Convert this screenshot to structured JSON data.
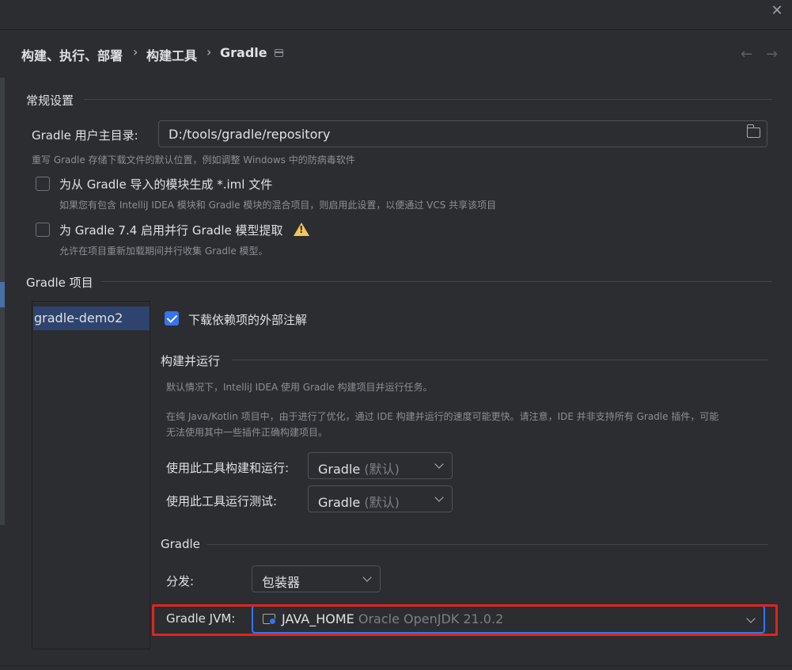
{
  "window": {
    "close_glyph": "✕"
  },
  "breadcrumb": {
    "items": [
      "构建、执行、部署",
      "构建工具",
      "Gradle"
    ],
    "separator": "›",
    "back_glyph": "←",
    "forward_glyph": "→"
  },
  "general": {
    "title": "常规设置",
    "user_home_label": "Gradle 用户主目录:",
    "user_home_value": "D:/tools/gradle/repository",
    "user_home_hint": "重写 Gradle 存储下载文件的默认位置，例如调整 Windows 中的防病毒软件",
    "iml_label": "为从 Gradle 导入的模块生成 *.iml 文件",
    "iml_hint": "如果您有包含 IntelliJ IDEA 模块和 Gradle 模块的混合项目，则启用此设置，以便通过 VCS 共享该项目",
    "iml_checked": false,
    "parallel_label": "为 Gradle 7.4 启用并行 Gradle 模型提取",
    "parallel_hint": "允许在项目重新加载期间并行收集 Gradle 模型。",
    "parallel_checked": false
  },
  "projects": {
    "title": "Gradle 项目",
    "items": [
      "gradle-demo2"
    ],
    "download_annotations_label": "下载依赖项的外部注解",
    "download_annotations_checked": true
  },
  "build_run": {
    "title": "构建并运行",
    "desc1": "默认情况下，IntelliJ IDEA 使用 Gradle 构建项目并运行任务。",
    "desc2_line1": "在纯 Java/Kotlin 项目中，由于进行了优化，通过 IDE 构建并运行的速度可能更快。请注意，IDE 并非支持所有 Gradle 插件，可能",
    "desc2_line2": "无法使用其中一些插件正确构建项目。",
    "build_with_label": "使用此工具构建和运行:",
    "build_with_value": "Gradle",
    "build_with_suffix": "(默认)",
    "test_with_label": "使用此工具运行测试:",
    "test_with_value": "Gradle",
    "test_with_suffix": "(默认)"
  },
  "gradle": {
    "title": "Gradle",
    "distribution_label": "分发:",
    "distribution_value": "包装器",
    "jvm_label": "Gradle JVM:",
    "jvm_value": "JAVA_HOME",
    "jvm_detail": "Oracle OpenJDK 21.0.2"
  },
  "colors": {
    "accent": "#3574f0",
    "highlight": "#e0241f",
    "warning": "#f2c55c"
  }
}
